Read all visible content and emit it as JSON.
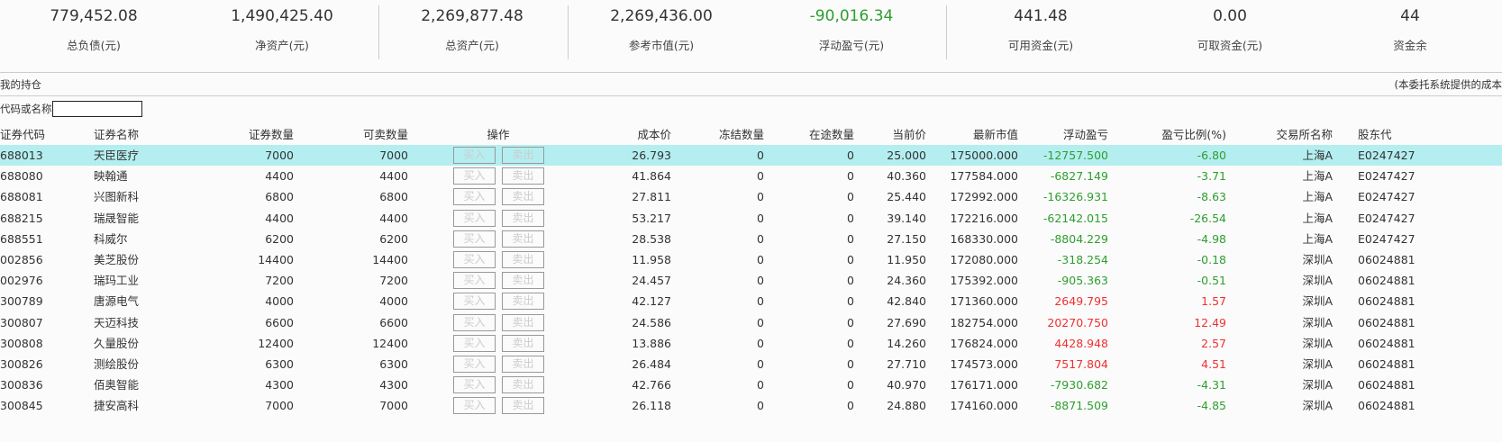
{
  "summary": [
    {
      "value": "779,452.08",
      "label": "总负债(元)"
    },
    {
      "value": "1,490,425.40",
      "label": "净资产(元)"
    },
    {
      "value": "2,269,877.48",
      "label": "总资产(元)"
    },
    {
      "value": "2,269,436.00",
      "label": "参考市值(元)"
    },
    {
      "value": "-90,016.34",
      "label": "浮动盈亏(元)",
      "color": "#2e9e2e"
    },
    {
      "value": "441.48",
      "label": "可用资金(元)"
    },
    {
      "value": "0.00",
      "label": "可取资金(元)"
    },
    {
      "value": "44",
      "label": "资金余"
    }
  ],
  "section_title": "我的持仓",
  "note": "(本委托系统提供的成本",
  "search_label": "代码或名称",
  "search_value": "",
  "columns": [
    "证券代码",
    "证券名称",
    "证券数量",
    "可卖数量",
    "操作",
    "成本价",
    "冻结数量",
    "在途数量",
    "当前价",
    "最新市值",
    "浮动盈亏",
    "盈亏比例(%)",
    "交易所名称",
    "股东代"
  ],
  "buy_label": "买入",
  "sell_label": "卖出",
  "colors": {
    "profit": "#f03030",
    "loss": "#2e9e2e",
    "selected_row": "#b4eef0"
  },
  "rows": [
    [
      "688013",
      "天臣医疗",
      "7000",
      "7000",
      "26.793",
      "0",
      "0",
      "25.000",
      "175000.000",
      "-12757.500",
      "-6.80",
      "上海A",
      "E0247427"
    ],
    [
      "688080",
      "映翰通",
      "4400",
      "4400",
      "41.864",
      "0",
      "0",
      "40.360",
      "177584.000",
      "-6827.149",
      "-3.71",
      "上海A",
      "E0247427"
    ],
    [
      "688081",
      "兴图新科",
      "6800",
      "6800",
      "27.811",
      "0",
      "0",
      "25.440",
      "172992.000",
      "-16326.931",
      "-8.63",
      "上海A",
      "E0247427"
    ],
    [
      "688215",
      "瑞晟智能",
      "4400",
      "4400",
      "53.217",
      "0",
      "0",
      "39.140",
      "172216.000",
      "-62142.015",
      "-26.54",
      "上海A",
      "E0247427"
    ],
    [
      "688551",
      "科威尔",
      "6200",
      "6200",
      "28.538",
      "0",
      "0",
      "27.150",
      "168330.000",
      "-8804.229",
      "-4.98",
      "上海A",
      "E0247427"
    ],
    [
      "002856",
      "美芝股份",
      "14400",
      "14400",
      "11.958",
      "0",
      "0",
      "11.950",
      "172080.000",
      "-318.254",
      "-0.18",
      "深圳A",
      "06024881"
    ],
    [
      "002976",
      "瑞玛工业",
      "7200",
      "7200",
      "24.457",
      "0",
      "0",
      "24.360",
      "175392.000",
      "-905.363",
      "-0.51",
      "深圳A",
      "06024881"
    ],
    [
      "300789",
      "唐源电气",
      "4000",
      "4000",
      "42.127",
      "0",
      "0",
      "42.840",
      "171360.000",
      "2649.795",
      "1.57",
      "深圳A",
      "06024881"
    ],
    [
      "300807",
      "天迈科技",
      "6600",
      "6600",
      "24.586",
      "0",
      "0",
      "27.690",
      "182754.000",
      "20270.750",
      "12.49",
      "深圳A",
      "06024881"
    ],
    [
      "300808",
      "久量股份",
      "12400",
      "12400",
      "13.886",
      "0",
      "0",
      "14.260",
      "176824.000",
      "4428.948",
      "2.57",
      "深圳A",
      "06024881"
    ],
    [
      "300826",
      "测绘股份",
      "6300",
      "6300",
      "26.484",
      "0",
      "0",
      "27.710",
      "174573.000",
      "7517.804",
      "4.51",
      "深圳A",
      "06024881"
    ],
    [
      "300836",
      "佰奥智能",
      "4300",
      "4300",
      "42.766",
      "0",
      "0",
      "40.970",
      "176171.000",
      "-7930.682",
      "-4.31",
      "深圳A",
      "06024881"
    ],
    [
      "300845",
      "捷安高科",
      "7000",
      "7000",
      "26.118",
      "0",
      "0",
      "24.880",
      "174160.000",
      "-8871.509",
      "-4.85",
      "深圳A",
      "06024881"
    ]
  ]
}
